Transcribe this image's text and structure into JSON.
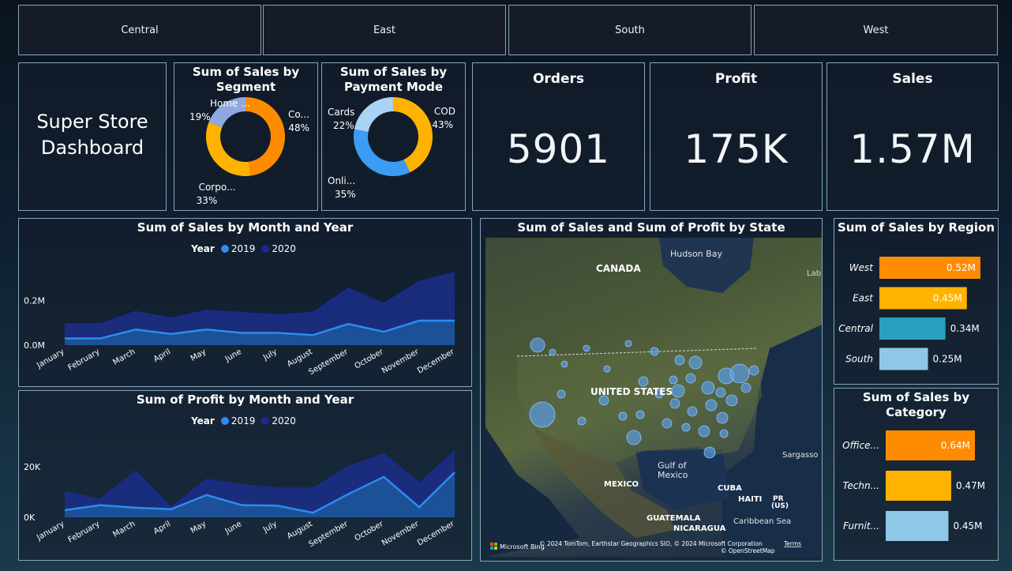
{
  "regions_slicer": [
    "Central",
    "East",
    "South",
    "West"
  ],
  "title_card": {
    "line1": "Super Store",
    "line2": "Dashboard"
  },
  "segment_donut": {
    "title_line1": "Sum of Sales by",
    "title_line2": "Segment",
    "slices": [
      {
        "label": "Co...",
        "pct": "48%",
        "value": 48,
        "color": "#ff8c00"
      },
      {
        "label": "Corpo...",
        "pct": "33%",
        "value": 33,
        "color": "#ffb300"
      },
      {
        "label": "Home ...",
        "pct": "19%",
        "value": 19,
        "color": "#8fa8e0"
      }
    ]
  },
  "payment_donut": {
    "title_line1": "Sum of Sales by",
    "title_line2": "Payment Mode",
    "slices": [
      {
        "label": "COD",
        "pct": "43%",
        "value": 43,
        "color": "#ffb300"
      },
      {
        "label": "Onli...",
        "pct": "35%",
        "value": 35,
        "color": "#3a9cf5"
      },
      {
        "label": "Cards",
        "pct": "22%",
        "value": 22,
        "color": "#a9d2f5"
      }
    ]
  },
  "kpis": {
    "orders": {
      "label": "Orders",
      "value": "5901"
    },
    "profit": {
      "label": "Profit",
      "value": "175K"
    },
    "sales": {
      "label": "Sales",
      "value": "1.57M"
    }
  },
  "legend": {
    "label": "Year",
    "y2019": "2019",
    "y2020": "2020",
    "color2019": "#2d8cf0",
    "color2020": "#1a2a8c"
  },
  "months": [
    "January",
    "February",
    "March",
    "April",
    "May",
    "June",
    "July",
    "August",
    "September",
    "October",
    "November",
    "December"
  ],
  "sales_chart": {
    "title": "Sum of Sales by Month and Year",
    "yticks": [
      "0.2M",
      "0.0M"
    ],
    "chart_data": {
      "type": "area",
      "categories": [
        "January",
        "February",
        "March",
        "April",
        "May",
        "June",
        "July",
        "August",
        "September",
        "October",
        "November",
        "December"
      ],
      "series": [
        {
          "name": "2019",
          "values": [
            0.03,
            0.03,
            0.07,
            0.05,
            0.07,
            0.055,
            0.055,
            0.045,
            0.095,
            0.06,
            0.11,
            0.11
          ]
        },
        {
          "name": "2020",
          "values": [
            0.095,
            0.095,
            0.15,
            0.12,
            0.155,
            0.145,
            0.135,
            0.145,
            0.255,
            0.185,
            0.285,
            0.325
          ]
        }
      ],
      "ylim": [
        0,
        0.34
      ],
      "title": "Sum of Sales by Month and Year"
    }
  },
  "profit_chart": {
    "title": "Sum of Profit by Month and Year",
    "yticks": [
      "20K",
      "0K"
    ],
    "chart_data": {
      "type": "area",
      "categories": [
        "January",
        "February",
        "March",
        "April",
        "May",
        "June",
        "July",
        "August",
        "September",
        "October",
        "November",
        "December"
      ],
      "series": [
        {
          "name": "2019",
          "values": [
            2800,
            4800,
            3800,
            3200,
            8800,
            4800,
            4600,
            1800,
            9200,
            16000,
            4000,
            17800
          ]
        },
        {
          "name": "2020",
          "values": [
            10000,
            7000,
            18200,
            3800,
            15000,
            12800,
            11500,
            11500,
            20000,
            25000,
            13500,
            26000
          ]
        }
      ],
      "ylim": [
        0,
        30000
      ],
      "title": "Sum of Profit by Month and Year"
    }
  },
  "map": {
    "title": "Sum of Sales and Sum of Profit by State",
    "labels": {
      "canada": "CANADA",
      "hudson": "Hudson Bay",
      "usa": "UNITED STATES",
      "gulf1": "Gulf of",
      "gulf2": "Mexico",
      "mexico": "MEXICO",
      "cuba": "CUBA",
      "haiti": "HAITI",
      "pr": "PR",
      "pr2": "(US)",
      "guatemala": "GUATEMALA",
      "nicaragua": "NICARAGUA",
      "caribbean": "Caribbean Sea",
      "sargasso": "Sargasso",
      "lab": "Lab"
    },
    "bing": "Microsoft Bing",
    "attribution": "© 2024 TomTom, Earthstar Geographics SIO, © 2024 Microsoft Corporation",
    "terms": "Terms",
    "osm": "© OpenStreetMap"
  },
  "region_bars": {
    "title": "Sum of Sales by Region",
    "chart_data": {
      "type": "bar",
      "categories": [
        "West",
        "East",
        "Central",
        "South"
      ],
      "values": [
        0.52,
        0.45,
        0.34,
        0.25
      ],
      "labels": [
        "0.52M",
        "0.45M",
        "0.34M",
        "0.25M"
      ],
      "colors": [
        "#ff8c00",
        "#ffb300",
        "#2aa0c0",
        "#8fc8e6"
      ],
      "title": "Sum of Sales by Region"
    }
  },
  "category_bars": {
    "title": "Sum of Sales by Category",
    "chart_data": {
      "type": "bar",
      "categories": [
        "Office...",
        "Techn...",
        "Furnit..."
      ],
      "values": [
        0.64,
        0.47,
        0.45
      ],
      "labels": [
        "0.64M",
        "0.47M",
        "0.45M"
      ],
      "colors": [
        "#ff8c00",
        "#ffb300",
        "#8fc8e6"
      ],
      "title": "Sum of Sales by Category"
    }
  }
}
